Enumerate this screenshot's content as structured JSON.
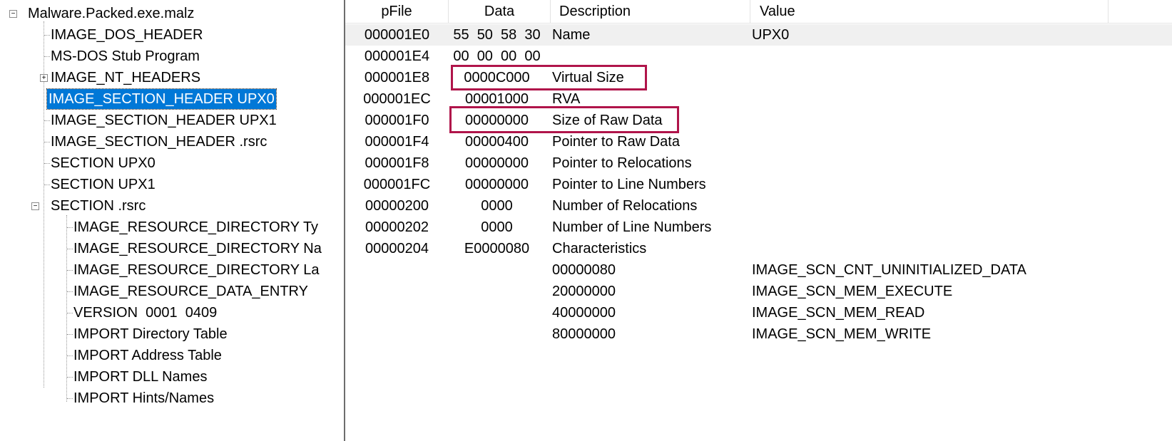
{
  "tree": {
    "root": "Malware.Packed.exe.malz",
    "items": [
      "IMAGE_DOS_HEADER",
      "MS-DOS Stub Program",
      "IMAGE_NT_HEADERS",
      "IMAGE_SECTION_HEADER UPX0",
      "IMAGE_SECTION_HEADER UPX1",
      "IMAGE_SECTION_HEADER .rsrc",
      "SECTION UPX0",
      "SECTION UPX1",
      "SECTION .rsrc"
    ],
    "rsrc_children": [
      "IMAGE_RESOURCE_DIRECTORY Ty",
      "IMAGE_RESOURCE_DIRECTORY Na",
      "IMAGE_RESOURCE_DIRECTORY La",
      "IMAGE_RESOURCE_DATA_ENTRY",
      "VERSION  0001  0409",
      "IMPORT Directory Table",
      "IMPORT Address Table",
      "IMPORT DLL Names",
      "IMPORT Hints/Names"
    ],
    "expand_glyphs": {
      "collapse": "−",
      "expand": "+"
    }
  },
  "columns": {
    "pfile": "pFile",
    "data": "Data",
    "description": "Description",
    "value": "Value"
  },
  "rows": [
    {
      "pfile": "000001E0",
      "data": "55  50  58  30",
      "description": "Name",
      "value": "UPX0"
    },
    {
      "pfile": "000001E4",
      "data": "00  00  00  00",
      "description": "",
      "value": ""
    },
    {
      "pfile": "000001E8",
      "data": "0000C000",
      "description": "Virtual Size",
      "value": ""
    },
    {
      "pfile": "000001EC",
      "data": "00001000",
      "description": "RVA",
      "value": ""
    },
    {
      "pfile": "000001F0",
      "data": "00000000",
      "description": "Size of Raw Data",
      "value": ""
    },
    {
      "pfile": "000001F4",
      "data": "00000400",
      "description": "Pointer to Raw Data",
      "value": ""
    },
    {
      "pfile": "000001F8",
      "data": "00000000",
      "description": "Pointer to Relocations",
      "value": ""
    },
    {
      "pfile": "000001FC",
      "data": "00000000",
      "description": "Pointer to Line Numbers",
      "value": ""
    },
    {
      "pfile": "00000200",
      "data": "0000",
      "description": "Number of Relocations",
      "value": ""
    },
    {
      "pfile": "00000202",
      "data": "0000",
      "description": "Number of Line Numbers",
      "value": ""
    },
    {
      "pfile": "00000204",
      "data": "E0000080",
      "description": "Characteristics",
      "value": ""
    },
    {
      "pfile": "",
      "data": "",
      "description": "00000080",
      "value": "IMAGE_SCN_CNT_UNINITIALIZED_DATA"
    },
    {
      "pfile": "",
      "data": "",
      "description": "20000000",
      "value": "IMAGE_SCN_MEM_EXECUTE"
    },
    {
      "pfile": "",
      "data": "",
      "description": "40000000",
      "value": "IMAGE_SCN_MEM_READ"
    },
    {
      "pfile": "",
      "data": "",
      "description": "80000000",
      "value": "IMAGE_SCN_MEM_WRITE"
    }
  ],
  "colors": {
    "selection": "#0078d7",
    "highlight_box": "#b0144a",
    "row_highlight": "#f0f0f0"
  }
}
